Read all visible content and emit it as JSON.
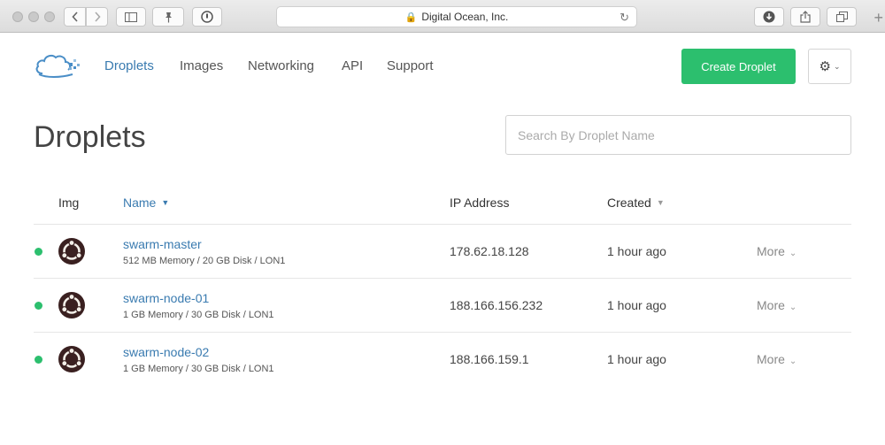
{
  "browser": {
    "url_text": "Digital Ocean, Inc.",
    "back_icon": "chevron-left-icon",
    "forward_icon": "chevron-right-icon",
    "sidebar_icon": "sidebar-icon",
    "pin_icon": "pin-icon",
    "lock_icon": "lock-icon"
  },
  "nav": {
    "items": [
      {
        "label": "Droplets",
        "active": true
      },
      {
        "label": "Images",
        "active": false
      },
      {
        "label": "Networking",
        "active": false
      },
      {
        "label": "API",
        "active": false
      },
      {
        "label": "Support",
        "active": false
      }
    ],
    "create_label": "Create Droplet",
    "settings_icon": "gear-icon"
  },
  "page": {
    "title": "Droplets",
    "search_placeholder": "Search By Droplet Name"
  },
  "table": {
    "headers": {
      "img": "Img",
      "name": "Name",
      "ip": "IP Address",
      "created": "Created"
    },
    "rows": [
      {
        "name": "swarm-master",
        "spec": "512 MB Memory / 20 GB Disk / LON1",
        "ip": "178.62.18.128",
        "created": "1 hour ago",
        "more": "More",
        "status": "active"
      },
      {
        "name": "swarm-node-01",
        "spec": "1 GB Memory / 30 GB Disk / LON1",
        "ip": "188.166.156.232",
        "created": "1 hour ago",
        "more": "More",
        "status": "active"
      },
      {
        "name": "swarm-node-02",
        "spec": "1 GB Memory / 30 GB Disk / LON1",
        "ip": "188.166.159.1",
        "created": "1 hour ago",
        "more": "More",
        "status": "active"
      }
    ]
  },
  "colors": {
    "accent": "#3a7bb0",
    "create_button": "#2cbf6e",
    "status_active": "#2cbf6e"
  }
}
